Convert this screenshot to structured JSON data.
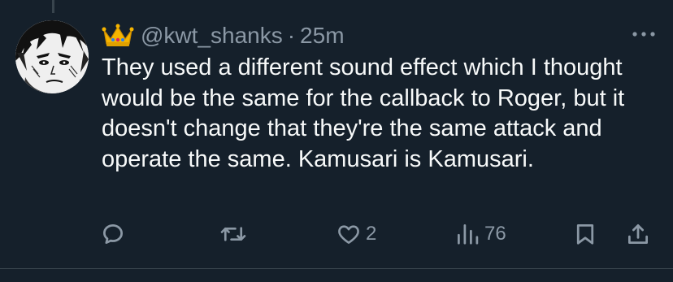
{
  "tweet": {
    "handle": "@kwt_shanks",
    "separator": "·",
    "time": "25m",
    "text": "They used a different sound effect which I thought would be the same for the callback to Roger, but it doesn't change that they're the same attack and operate the same. Kamusari is Kamusari."
  },
  "actions": {
    "reply_count": "",
    "retweet_count": "",
    "like_count": "2",
    "views_count": "76"
  },
  "icons": {
    "name_emoji": "crown-icon",
    "more": "more-options-icon",
    "reply": "reply-icon",
    "retweet": "retweet-icon",
    "like": "heart-icon",
    "views": "views-chart-icon",
    "bookmark": "bookmark-icon",
    "share": "share-icon"
  },
  "colors": {
    "background": "#15202b",
    "text_primary": "#f7f9f9",
    "text_secondary": "#8b98a5",
    "divider": "#38444d"
  }
}
